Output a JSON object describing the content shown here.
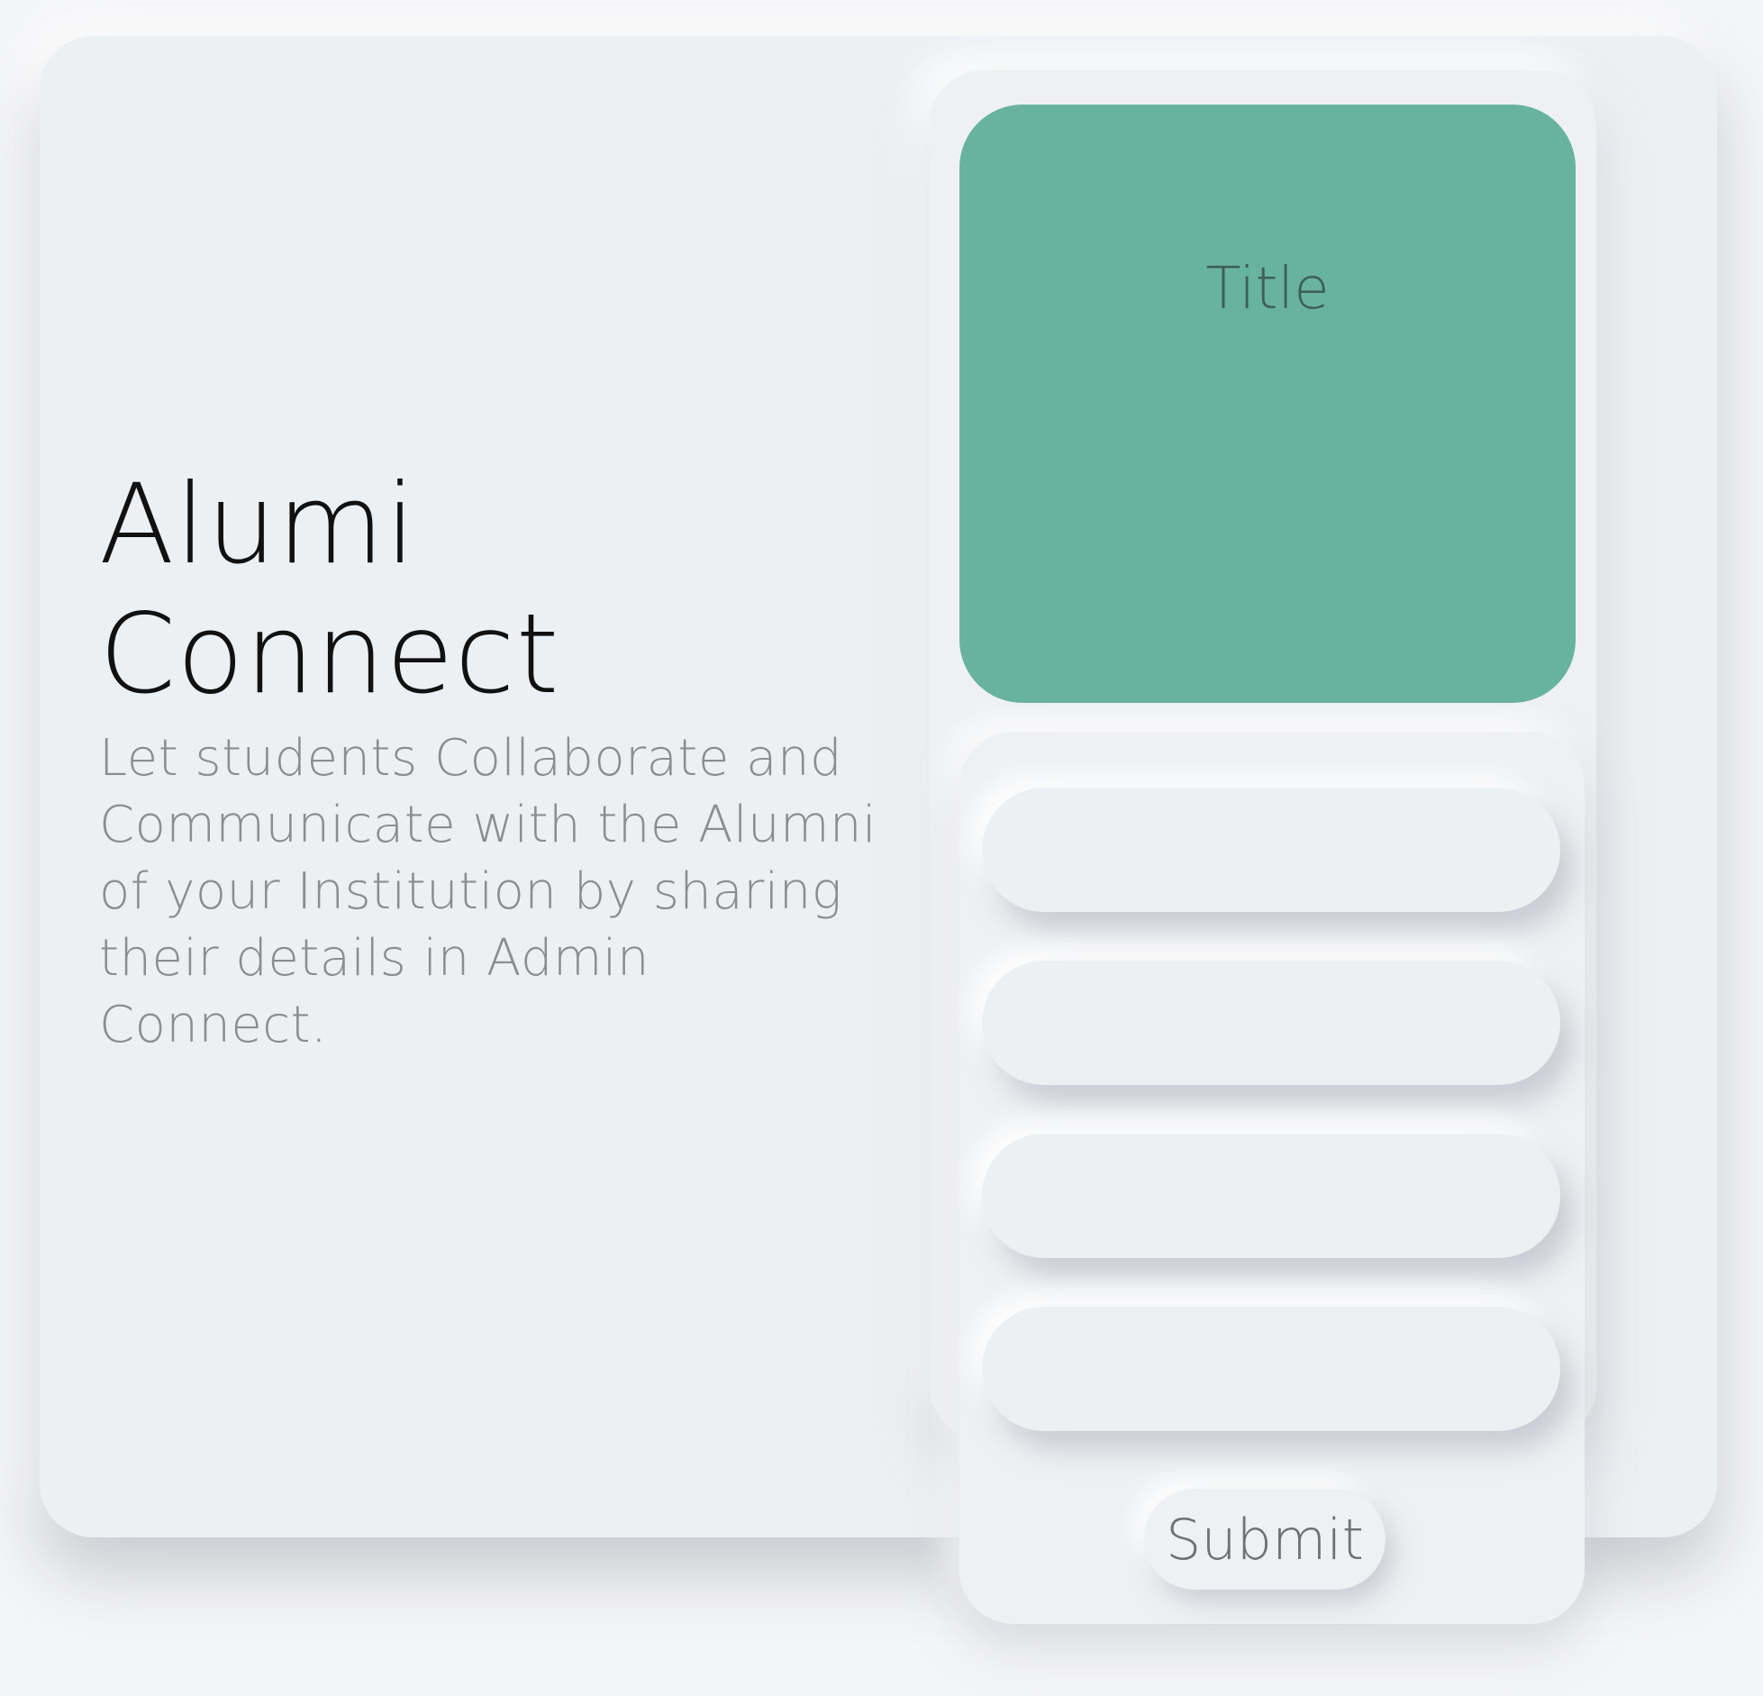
{
  "hero": {
    "title_line1": "Alumi",
    "title_line2": "Connect",
    "description": "Let students Collaborate and Communicate with the Alumni of your Institution by sharing their details in Admin Connect."
  },
  "form": {
    "header_title": "Title",
    "fields": [
      {
        "value": "",
        "placeholder": ""
      },
      {
        "value": "",
        "placeholder": ""
      },
      {
        "value": "",
        "placeholder": ""
      },
      {
        "value": "",
        "placeholder": ""
      }
    ],
    "submit_label": "Submit"
  },
  "colors": {
    "accent": "#68b3a0",
    "background": "#edf0f3"
  }
}
